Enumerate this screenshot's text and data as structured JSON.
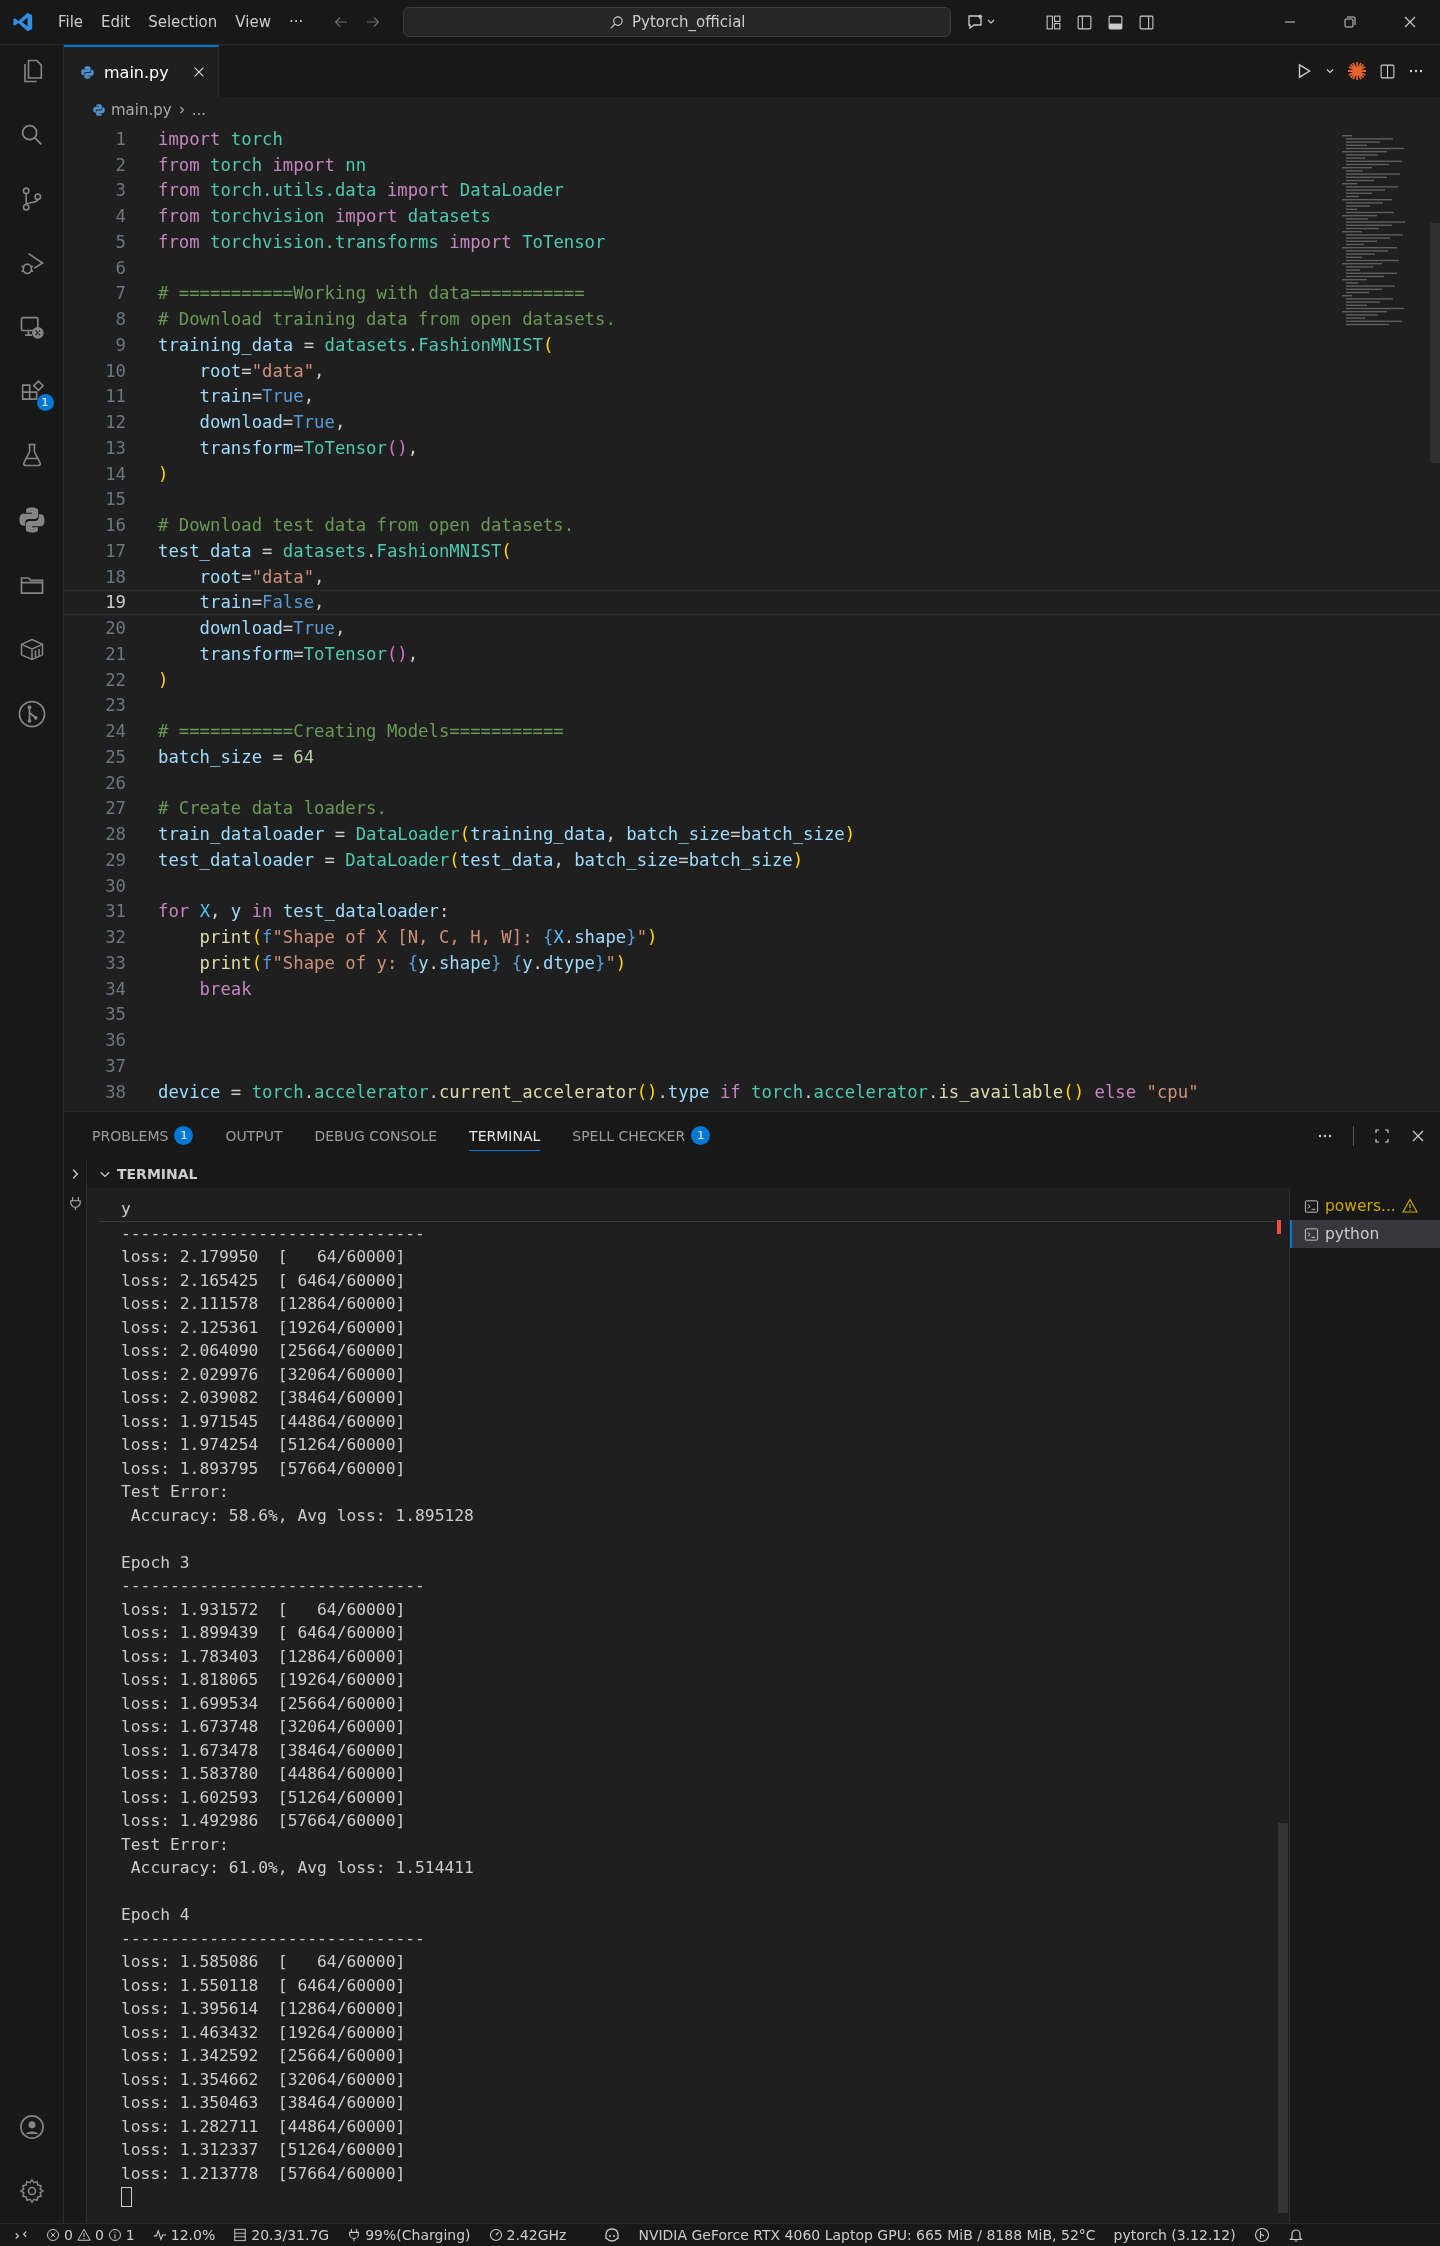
{
  "title_bar": {
    "menu": [
      "File",
      "Edit",
      "Selection",
      "View",
      "···"
    ],
    "search": {
      "value": "Pytorch_official"
    }
  },
  "activity_bar": {
    "extensions_badge": "1"
  },
  "editor": {
    "tabs": [
      {
        "label": "main.py",
        "selected": true
      }
    ],
    "breadcrumb": {
      "file": "main.py",
      "rest": "..."
    },
    "lines": [
      {
        "number": "1",
        "tokens": [
          {
            "text": "import ",
            "kind": "kw"
          },
          {
            "text": "torch",
            "kind": "cls"
          }
        ]
      },
      {
        "number": "2",
        "tokens": [
          {
            "text": "from ",
            "kind": "kw"
          },
          {
            "text": "torch ",
            "kind": "cls"
          },
          {
            "text": "import ",
            "kind": "kw"
          },
          {
            "text": "nn",
            "kind": "cls"
          }
        ]
      },
      {
        "number": "3",
        "tokens": [
          {
            "text": "from ",
            "kind": "kw"
          },
          {
            "text": "torch.utils.data ",
            "kind": "cls"
          },
          {
            "text": "import ",
            "kind": "kw"
          },
          {
            "text": "DataLoader",
            "kind": "cls"
          }
        ]
      },
      {
        "number": "4",
        "tokens": [
          {
            "text": "from ",
            "kind": "kw"
          },
          {
            "text": "torchvision ",
            "kind": "cls"
          },
          {
            "text": "import ",
            "kind": "kw"
          },
          {
            "text": "datasets",
            "kind": "cls"
          }
        ]
      },
      {
        "number": "5",
        "tokens": [
          {
            "text": "from ",
            "kind": "kw"
          },
          {
            "text": "torchvision.transforms ",
            "kind": "cls"
          },
          {
            "text": "import ",
            "kind": "kw"
          },
          {
            "text": "ToTensor",
            "kind": "cls"
          }
        ]
      },
      {
        "number": "6"
      },
      {
        "number": "7",
        "tokens": [
          {
            "text": "# ===========Working with data===========",
            "kind": "cmt"
          }
        ]
      },
      {
        "number": "8",
        "tokens": [
          {
            "text": "# Download training data from open datasets.",
            "kind": "cmt"
          }
        ]
      },
      {
        "number": "9",
        "tokens": [
          {
            "text": "training_data",
            "kind": "var"
          },
          {
            "text": " = ",
            "kind": "p"
          },
          {
            "text": "datasets",
            "kind": "cls"
          },
          {
            "text": ".",
            "kind": "p"
          },
          {
            "text": "FashionMNIST",
            "kind": "cls"
          },
          {
            "text": "(",
            "kind": "b1"
          }
        ]
      },
      {
        "number": "10",
        "tokens": [
          {
            "text": "    root",
            "kind": "var"
          },
          {
            "text": "=",
            "kind": "p"
          },
          {
            "text": "\"data\"",
            "kind": "str"
          },
          {
            "text": ",",
            "kind": "p"
          }
        ]
      },
      {
        "number": "11",
        "tokens": [
          {
            "text": "    train",
            "kind": "var"
          },
          {
            "text": "=",
            "kind": "p"
          },
          {
            "text": "True",
            "kind": "const"
          },
          {
            "text": ",",
            "kind": "p"
          }
        ]
      },
      {
        "number": "12",
        "tokens": [
          {
            "text": "    download",
            "kind": "var"
          },
          {
            "text": "=",
            "kind": "p"
          },
          {
            "text": "True",
            "kind": "const"
          },
          {
            "text": ",",
            "kind": "p"
          }
        ]
      },
      {
        "number": "13",
        "tokens": [
          {
            "text": "    transform",
            "kind": "var"
          },
          {
            "text": "=",
            "kind": "p"
          },
          {
            "text": "ToTensor",
            "kind": "cls"
          },
          {
            "text": "()",
            "kind": "b2"
          },
          {
            "text": ",",
            "kind": "p"
          }
        ]
      },
      {
        "number": "14",
        "tokens": [
          {
            "text": ")",
            "kind": "b1"
          }
        ]
      },
      {
        "number": "15"
      },
      {
        "number": "16",
        "tokens": [
          {
            "text": "# Download test data from open datasets.",
            "kind": "cmt"
          }
        ]
      },
      {
        "number": "17",
        "tokens": [
          {
            "text": "test_data",
            "kind": "var"
          },
          {
            "text": " = ",
            "kind": "p"
          },
          {
            "text": "datasets",
            "kind": "cls"
          },
          {
            "text": ".",
            "kind": "p"
          },
          {
            "text": "FashionMNIST",
            "kind": "cls"
          },
          {
            "text": "(",
            "kind": "b1"
          }
        ]
      },
      {
        "number": "18",
        "tokens": [
          {
            "text": "    root",
            "kind": "var"
          },
          {
            "text": "=",
            "kind": "p"
          },
          {
            "text": "\"data\"",
            "kind": "str"
          },
          {
            "text": ",",
            "kind": "p"
          }
        ]
      },
      {
        "number": "19",
        "current": true,
        "tokens": [
          {
            "text": "    train",
            "kind": "var"
          },
          {
            "text": "=",
            "kind": "p"
          },
          {
            "text": "False",
            "kind": "const"
          },
          {
            "text": ",",
            "kind": "p"
          }
        ]
      },
      {
        "number": "20",
        "tokens": [
          {
            "text": "    download",
            "kind": "var"
          },
          {
            "text": "=",
            "kind": "p"
          },
          {
            "text": "True",
            "kind": "const"
          },
          {
            "text": ",",
            "kind": "p"
          }
        ]
      },
      {
        "number": "21",
        "tokens": [
          {
            "text": "    transform",
            "kind": "var"
          },
          {
            "text": "=",
            "kind": "p"
          },
          {
            "text": "ToTensor",
            "kind": "cls"
          },
          {
            "text": "()",
            "kind": "b2"
          },
          {
            "text": ",",
            "kind": "p"
          }
        ]
      },
      {
        "number": "22",
        "tokens": [
          {
            "text": ")",
            "kind": "b1"
          }
        ]
      },
      {
        "number": "23"
      },
      {
        "number": "24",
        "tokens": [
          {
            "text": "# ===========Creating Models===========",
            "kind": "cmt"
          }
        ]
      },
      {
        "number": "25",
        "tokens": [
          {
            "text": "batch_size",
            "kind": "var"
          },
          {
            "text": " = ",
            "kind": "p"
          },
          {
            "text": "64",
            "kind": "num"
          }
        ]
      },
      {
        "number": "26"
      },
      {
        "number": "27",
        "tokens": [
          {
            "text": "# Create data loaders.",
            "kind": "cmt"
          }
        ]
      },
      {
        "number": "28",
        "tokens": [
          {
            "text": "train_dataloader",
            "kind": "var"
          },
          {
            "text": " = ",
            "kind": "p"
          },
          {
            "text": "DataLoader",
            "kind": "cls"
          },
          {
            "text": "(",
            "kind": "b1"
          },
          {
            "text": "training_data",
            "kind": "var"
          },
          {
            "text": ", ",
            "kind": "p"
          },
          {
            "text": "batch_size",
            "kind": "var"
          },
          {
            "text": "=",
            "kind": "p"
          },
          {
            "text": "batch_size",
            "kind": "var"
          },
          {
            "text": ")",
            "kind": "b1"
          }
        ]
      },
      {
        "number": "29",
        "tokens": [
          {
            "text": "test_dataloader",
            "kind": "var"
          },
          {
            "text": " = ",
            "kind": "p"
          },
          {
            "text": "DataLoader",
            "kind": "cls"
          },
          {
            "text": "(",
            "kind": "b1"
          },
          {
            "text": "test_data",
            "kind": "var"
          },
          {
            "text": ", ",
            "kind": "p"
          },
          {
            "text": "batch_size",
            "kind": "var"
          },
          {
            "text": "=",
            "kind": "p"
          },
          {
            "text": "batch_size",
            "kind": "var"
          },
          {
            "text": ")",
            "kind": "b1"
          }
        ]
      },
      {
        "number": "30"
      },
      {
        "number": "31",
        "tokens": [
          {
            "text": "for ",
            "kind": "kw"
          },
          {
            "text": "X",
            "kind": "cvar"
          },
          {
            "text": ", ",
            "kind": "p"
          },
          {
            "text": "y ",
            "kind": "var"
          },
          {
            "text": "in ",
            "kind": "kw"
          },
          {
            "text": "test_dataloader",
            "kind": "var"
          },
          {
            "text": ":",
            "kind": "p"
          }
        ]
      },
      {
        "number": "32",
        "tokens": [
          {
            "text": "    print",
            "kind": "fn"
          },
          {
            "text": "(",
            "kind": "b1"
          },
          {
            "text": "f",
            "kind": "const"
          },
          {
            "text": "\"Shape of X [N, C, H, W]: ",
            "kind": "str"
          },
          {
            "text": "{",
            "kind": "const"
          },
          {
            "text": "X",
            "kind": "cvar"
          },
          {
            "text": ".",
            "kind": "p"
          },
          {
            "text": "shape",
            "kind": "var"
          },
          {
            "text": "}",
            "kind": "const"
          },
          {
            "text": "\"",
            "kind": "str"
          },
          {
            "text": ")",
            "kind": "b1"
          }
        ]
      },
      {
        "number": "33",
        "tokens": [
          {
            "text": "    print",
            "kind": "fn"
          },
          {
            "text": "(",
            "kind": "b1"
          },
          {
            "text": "f",
            "kind": "const"
          },
          {
            "text": "\"Shape of y: ",
            "kind": "str"
          },
          {
            "text": "{",
            "kind": "const"
          },
          {
            "text": "y",
            "kind": "var"
          },
          {
            "text": ".",
            "kind": "p"
          },
          {
            "text": "shape",
            "kind": "var"
          },
          {
            "text": "} ",
            "kind": "const"
          },
          {
            "text": "{",
            "kind": "const"
          },
          {
            "text": "y",
            "kind": "var"
          },
          {
            "text": ".",
            "kind": "p"
          },
          {
            "text": "dtype",
            "kind": "var"
          },
          {
            "text": "}",
            "kind": "const"
          },
          {
            "text": "\"",
            "kind": "str"
          },
          {
            "text": ")",
            "kind": "b1"
          }
        ]
      },
      {
        "number": "34",
        "tokens": [
          {
            "text": "    break",
            "kind": "kw"
          }
        ]
      },
      {
        "number": "35"
      },
      {
        "number": "36"
      },
      {
        "number": "37"
      },
      {
        "number": "38",
        "tokens": [
          {
            "text": "device",
            "kind": "var"
          },
          {
            "text": " = ",
            "kind": "p"
          },
          {
            "text": "torch",
            "kind": "cls"
          },
          {
            "text": ".",
            "kind": "p"
          },
          {
            "text": "accelerator",
            "kind": "cls"
          },
          {
            "text": ".",
            "kind": "p"
          },
          {
            "text": "current_accelerator",
            "kind": "fn"
          },
          {
            "text": "()",
            "kind": "b1"
          },
          {
            "text": ".",
            "kind": "p"
          },
          {
            "text": "type ",
            "kind": "var"
          },
          {
            "text": "if ",
            "kind": "kw"
          },
          {
            "text": "torch",
            "kind": "cls"
          },
          {
            "text": ".",
            "kind": "p"
          },
          {
            "text": "accelerator",
            "kind": "cls"
          },
          {
            "text": ".",
            "kind": "p"
          },
          {
            "text": "is_available",
            "kind": "fn"
          },
          {
            "text": "()",
            "kind": "b1"
          },
          {
            "text": " else ",
            "kind": "kw"
          },
          {
            "text": "\"cpu\"",
            "kind": "str"
          }
        ]
      }
    ]
  },
  "panel": {
    "tabs": [
      {
        "label": "PROBLEMS",
        "badge": "1",
        "selected": false
      },
      {
        "label": "OUTPUT",
        "selected": false
      },
      {
        "label": "DEBUG CONSOLE",
        "selected": false
      },
      {
        "label": "TERMINAL",
        "selected": true
      },
      {
        "label": "SPELL CHECKER",
        "badge": "1",
        "selected": false
      }
    ],
    "section_title": "TERMINAL",
    "sticky_line": "y",
    "output": [
      {
        "lines": [
          {
            "text": "-------------------------------"
          },
          {
            "text": "loss: 2.179950  [   64/60000]"
          },
          {
            "text": "loss: 2.165425  [ 6464/60000]"
          },
          {
            "text": "loss: 2.111578  [12864/60000]"
          },
          {
            "text": "loss: 2.125361  [19264/60000]"
          },
          {
            "text": "loss: 2.064090  [25664/60000]"
          },
          {
            "text": "loss: 2.029976  [32064/60000]"
          },
          {
            "text": "loss: 2.039082  [38464/60000]"
          },
          {
            "text": "loss: 1.971545  [44864/60000]"
          },
          {
            "text": "loss: 1.974254  [51264/60000]"
          },
          {
            "text": "loss: 1.893795  [57664/60000]"
          },
          {
            "text": "Test Error:"
          },
          {
            "text": " Accuracy: 58.6%, Avg loss: 1.895128"
          }
        ]
      },
      {
        "lines": [
          {
            "text": "Epoch 3"
          },
          {
            "text": "-------------------------------"
          },
          {
            "text": "loss: 1.931572  [   64/60000]"
          },
          {
            "text": "loss: 1.899439  [ 6464/60000]"
          },
          {
            "text": "loss: 1.783403  [12864/60000]"
          },
          {
            "text": "loss: 1.818065  [19264/60000]"
          },
          {
            "text": "loss: 1.699534  [25664/60000]"
          },
          {
            "text": "loss: 1.673748  [32064/60000]"
          },
          {
            "text": "loss: 1.673478  [38464/60000]"
          },
          {
            "text": "loss: 1.583780  [44864/60000]"
          },
          {
            "text": "loss: 1.602593  [51264/60000]"
          },
          {
            "text": "loss: 1.492986  [57664/60000]"
          },
          {
            "text": "Test Error:"
          },
          {
            "text": " Accuracy: 61.0%, Avg loss: 1.514411"
          }
        ]
      },
      {
        "lines": [
          {
            "text": "Epoch 4"
          },
          {
            "text": "-------------------------------"
          },
          {
            "text": "loss: 1.585086  [   64/60000]"
          },
          {
            "text": "loss: 1.550118  [ 6464/60000]"
          },
          {
            "text": "loss: 1.395614  [12864/60000]"
          },
          {
            "text": "loss: 1.463432  [19264/60000]"
          },
          {
            "text": "loss: 1.342592  [25664/60000]"
          },
          {
            "text": "loss: 1.354662  [32064/60000]"
          },
          {
            "text": "loss: 1.350463  [38464/60000]"
          },
          {
            "text": "loss: 1.282711  [44864/60000]"
          },
          {
            "text": "loss: 1.312337  [51264/60000]"
          },
          {
            "text": "loss: 1.213778  [57664/60000]"
          }
        ]
      }
    ],
    "terminals": [
      {
        "label": "powers...",
        "warning": true,
        "selected": false
      },
      {
        "label": "python",
        "warning": false,
        "selected": true
      }
    ]
  },
  "status_bar": {
    "errors": "0",
    "warnings": "0",
    "infos": "1",
    "cpu": "12.0%",
    "memory": "20.3/31.7G",
    "battery": "99%(Charging)",
    "clock": "2.42GHz",
    "gpu": "NVIDIA GeForce RTX 4060 Laptop GPU: 665 MiB / 8188 MiB, 52°C",
    "python_env": "pytorch (3.12.12)"
  }
}
